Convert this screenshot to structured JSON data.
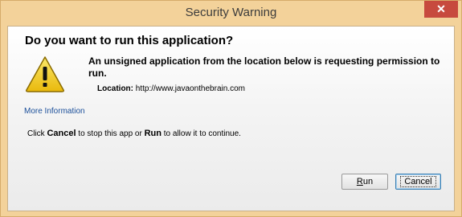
{
  "window": {
    "title": "Security Warning",
    "close_glyph": "✕"
  },
  "dialog": {
    "heading": "Do you want to run this application?",
    "message": "An unsigned application from the location below is requesting permission to run.",
    "location_label": "Location:",
    "location_value": "http://www.javaonthebrain.com",
    "more_info_link": "More Information",
    "instruction": {
      "part1": "Click ",
      "cancel_word": "Cancel",
      "part2": " to stop this app or ",
      "run_word": "Run",
      "part3": " to allow it to continue."
    }
  },
  "buttons": {
    "run_mnemonic": "R",
    "run_rest": "un",
    "cancel": "Cancel"
  },
  "icons": {
    "warning": "warning-triangle-icon",
    "close": "close-icon"
  },
  "colors": {
    "titlebar": "#f3d29a",
    "close_button": "#c74a3e",
    "link": "#1b4f9a",
    "warning_yellow": "#f6d12c"
  }
}
